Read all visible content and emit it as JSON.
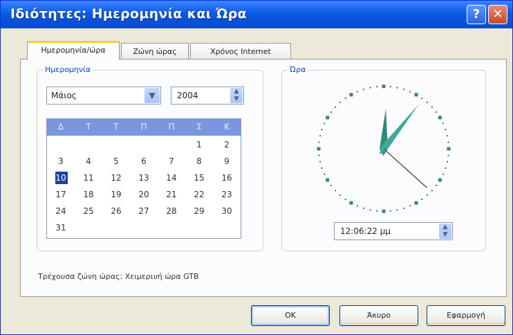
{
  "window": {
    "title": "Ιδιότητες: Ημερομηνία και Ώρα",
    "help_glyph": "?",
    "close_glyph": "✕"
  },
  "tabs": [
    {
      "label": "Ημερομηνία/ώρα",
      "active": true
    },
    {
      "label": "Ζώνη ώρας",
      "active": false
    },
    {
      "label": "Χρόνος Internet",
      "active": false
    }
  ],
  "date": {
    "group_label": "Ημερομηνία",
    "month": "Μάιος",
    "year": "2004",
    "dropdown_icon": "chevron-down-icon",
    "weekdays": [
      "Δ",
      "Τ",
      "Τ",
      "Π",
      "Π",
      "Σ",
      "Κ"
    ],
    "days": [
      [
        "",
        "",
        "",
        "",
        "",
        "1",
        "2"
      ],
      [
        "3",
        "4",
        "5",
        "6",
        "7",
        "8",
        "9"
      ],
      [
        "10",
        "11",
        "12",
        "13",
        "14",
        "15",
        "16"
      ],
      [
        "17",
        "18",
        "19",
        "20",
        "21",
        "22",
        "23"
      ],
      [
        "24",
        "25",
        "26",
        "27",
        "28",
        "29",
        "30"
      ],
      [
        "31",
        "",
        "",
        "",
        "",
        "",
        ""
      ]
    ],
    "selected_day": "10",
    "header_color": "#7a96df",
    "selected_color": "#1f3f9f"
  },
  "time": {
    "group_label": "Ώρα",
    "value": "12:06:22 μμ",
    "hour": 12,
    "minute": 6,
    "second": 22,
    "hand_color": "#2e8b7a"
  },
  "timezone": {
    "text": "Τρέχουσα ζώνη ώρας:  Χειμερινή ώρα GTB"
  },
  "buttons": {
    "ok": "OK",
    "cancel": "Άκυρο",
    "apply": "Εφαρμογή"
  }
}
